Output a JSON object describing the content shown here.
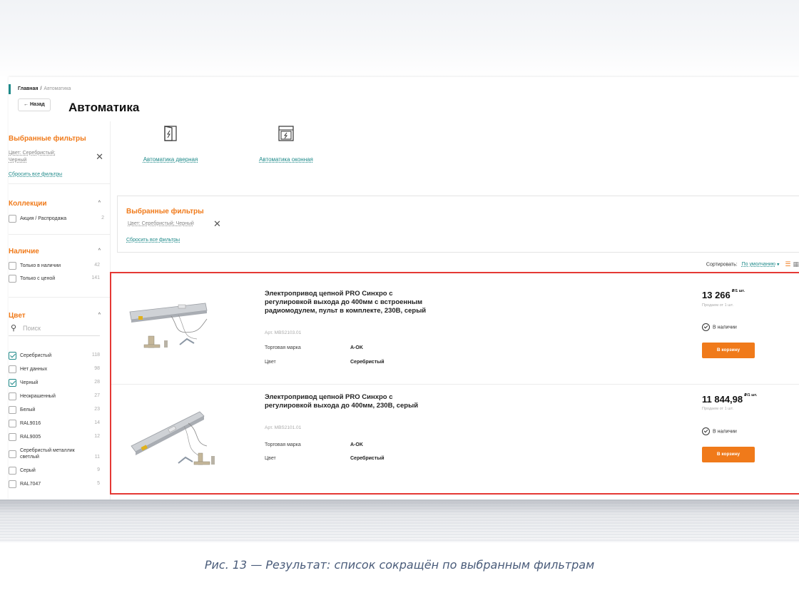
{
  "breadcrumb": {
    "home": "Главная",
    "separator": "/",
    "current": "Автоматика"
  },
  "header": {
    "back_label": "← Назад",
    "title": "Автоматика"
  },
  "sidebar": {
    "selected_filters": {
      "title": "Выбранные фильтры",
      "chip": "Цвет: Серебристый; Черный",
      "reset": "Сбросить все фильтры"
    },
    "collections": {
      "title": "Коллекции",
      "items": [
        {
          "label": "Акция / Распродажа",
          "count": "2",
          "checked": false
        }
      ]
    },
    "availability": {
      "title": "Наличие",
      "items": [
        {
          "label": "Только в наличии",
          "count": "42",
          "checked": false
        },
        {
          "label": "Только с ценой",
          "count": "141",
          "checked": false
        }
      ]
    },
    "color": {
      "title": "Цвет",
      "search_placeholder": "Поиск",
      "items": [
        {
          "label": "Серебристый",
          "count": "118",
          "checked": true
        },
        {
          "label": "Нет данных",
          "count": "98",
          "checked": false
        },
        {
          "label": "Черный",
          "count": "28",
          "checked": true
        },
        {
          "label": "Неокрашенный",
          "count": "27",
          "checked": false
        },
        {
          "label": "Белый",
          "count": "23",
          "checked": false
        },
        {
          "label": "RAL9016",
          "count": "14",
          "checked": false
        },
        {
          "label": "RAL9005",
          "count": "12",
          "checked": false
        },
        {
          "label": "Серебристый металлик светлый",
          "count": "11",
          "checked": false
        },
        {
          "label": "Серый",
          "count": "9",
          "checked": false
        },
        {
          "label": "RAL7047",
          "count": "5",
          "checked": false
        }
      ]
    }
  },
  "categories": [
    {
      "label": "Автоматика дверная",
      "icon": "door-automation-icon"
    },
    {
      "label": "Автоматика оконная",
      "icon": "window-automation-icon"
    }
  ],
  "filter_panel": {
    "title": "Выбранные фильтры",
    "chip": "Цвет: Серебристый; Черный",
    "reset": "Сбросить все фильтры"
  },
  "sort": {
    "label": "Сортировать:",
    "value": "По умолчанию",
    "caret": "▾"
  },
  "products": [
    {
      "title": "Электропривод цепной PRO Синхро с регулировкой выхода до 400мм с встроенным радиомодулем, пульт в комплекте, 230В, серый",
      "article": "Арт. MBS2103.01",
      "brand_label": "Торговая марка",
      "brand": "A-OK",
      "color_label": "Цвет",
      "color": "Серебристый",
      "price": "13 266",
      "price_unit": "₽/1 шт.",
      "sold_by": "Продаем от 1 шт.",
      "stock": "В наличии",
      "cart_label": "В корзину"
    },
    {
      "title": "Электропривод цепной PRO Синхро с регулировкой выхода до 400мм, 230В, серый",
      "article": "Арт. MBS2101.01",
      "brand_label": "Торговая марка",
      "brand": "A-OK",
      "color_label": "Цвет",
      "color": "Серебристый",
      "price": "11 844,98",
      "price_unit": "₽/1 шт.",
      "sold_by": "Продаем от 1 шт.",
      "stock": "В наличии",
      "cart_label": "В корзину"
    }
  ],
  "caption": "Рис. 13 — Результат: список сокращён по выбранным фильтрам",
  "colors": {
    "accent": "#f07a1a",
    "link": "#1f8a8a",
    "highlight": "#e53935"
  }
}
